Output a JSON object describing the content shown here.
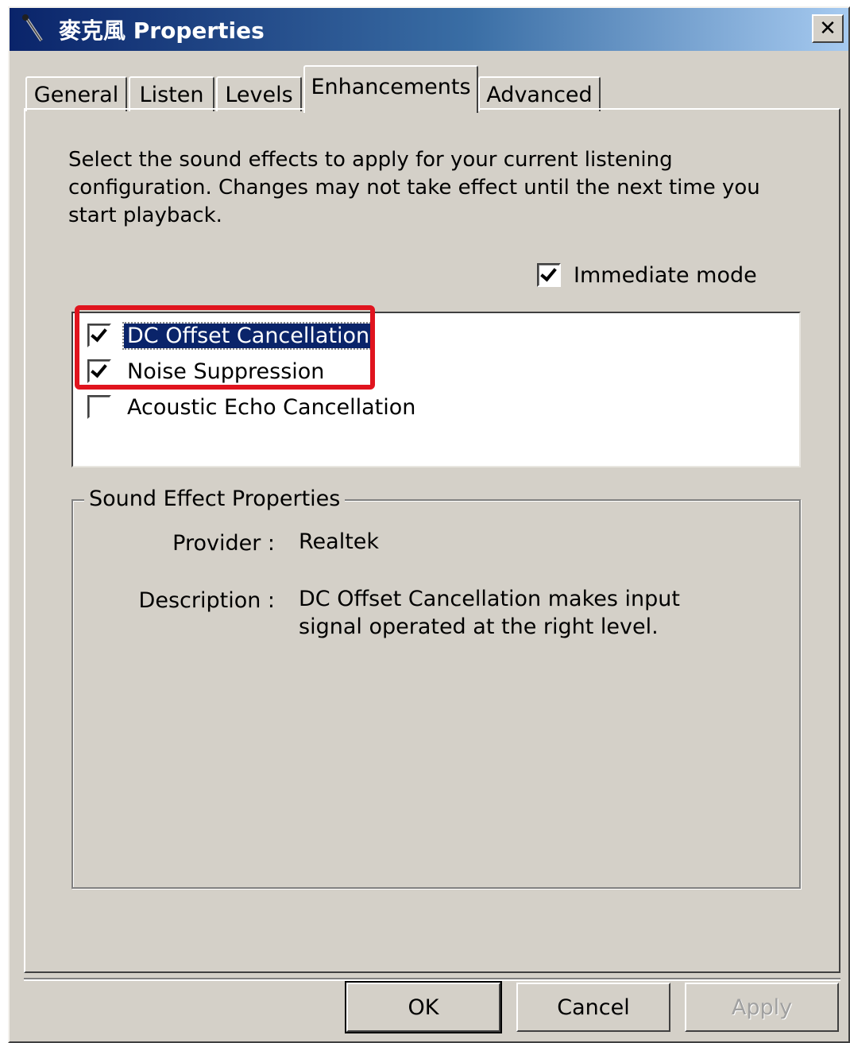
{
  "window": {
    "title": "麥克風 Properties",
    "icon": "microphone-icon",
    "close_label": "✕"
  },
  "tabs": [
    {
      "label": "General",
      "active": false
    },
    {
      "label": "Listen",
      "active": false
    },
    {
      "label": "Levels",
      "active": false
    },
    {
      "label": "Enhancements",
      "active": true
    },
    {
      "label": "Advanced",
      "active": false
    }
  ],
  "enhancements": {
    "intro": "Select the sound effects to apply for your current listening configuration. Changes may not take effect until the next time you start playback.",
    "immediate_mode": {
      "label": "Immediate mode",
      "checked": true
    },
    "effects": [
      {
        "label": "DC Offset Cancellation",
        "checked": true,
        "selected": true
      },
      {
        "label": "Noise Suppression",
        "checked": true,
        "selected": false
      },
      {
        "label": "Acoustic Echo Cancellation",
        "checked": false,
        "selected": false
      }
    ],
    "properties": {
      "legend": "Sound Effect Properties",
      "provider_label": "Provider :",
      "provider_value": "Realtek",
      "description_label": "Description :",
      "description_value": "DC Offset Cancellation makes input signal operated at the right level."
    },
    "highlight_color": "#e0141e"
  },
  "buttons": {
    "ok": "OK",
    "cancel": "Cancel",
    "apply": "Apply"
  }
}
